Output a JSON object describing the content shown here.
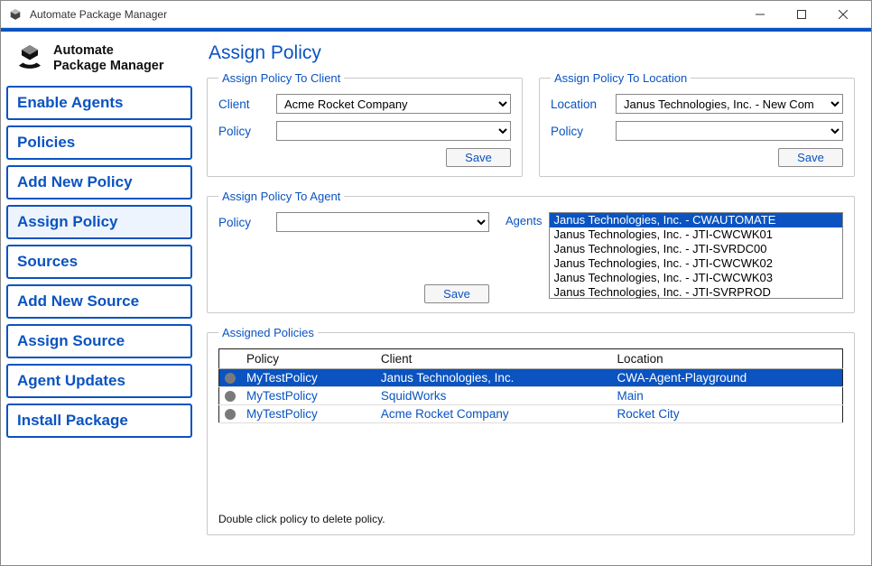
{
  "window": {
    "title": "Automate Package Manager"
  },
  "brand": {
    "line1": "Automate",
    "line2": "Package Manager"
  },
  "sidebar": {
    "items": [
      {
        "label": "Enable Agents"
      },
      {
        "label": "Policies"
      },
      {
        "label": "Add New Policy"
      },
      {
        "label": "Assign Policy"
      },
      {
        "label": "Sources"
      },
      {
        "label": "Add New Source"
      },
      {
        "label": "Assign Source"
      },
      {
        "label": "Agent Updates"
      },
      {
        "label": "Install Package"
      }
    ],
    "active_index": 3
  },
  "page": {
    "title": "Assign Policy"
  },
  "groups": {
    "client": {
      "legend": "Assign Policy To Client",
      "client_label": "Client",
      "policy_label": "Policy",
      "client_value": "Acme Rocket Company",
      "policy_value": "",
      "save_label": "Save"
    },
    "location": {
      "legend": "Assign Policy To Location",
      "location_label": "Location",
      "policy_label": "Policy",
      "location_value": "Janus Technologies, Inc. - New Com",
      "policy_value": "",
      "save_label": "Save"
    },
    "agent": {
      "legend": "Assign Policy To Agent",
      "policy_label": "Policy",
      "agents_label": "Agents",
      "policy_value": "",
      "save_label": "Save",
      "agents": [
        "Janus Technologies, Inc. - CWAUTOMATE",
        "Janus Technologies, Inc. - JTI-CWCWK01",
        "Janus Technologies, Inc. - JTI-SVRDC00",
        "Janus Technologies, Inc. - JTI-CWCWK02",
        "Janus Technologies, Inc. - JTI-CWCWK03",
        "Janus Technologies, Inc. - JTI-SVRPROD"
      ],
      "selected_agent_index": 0
    },
    "assigned": {
      "legend": "Assigned Policies",
      "columns": {
        "policy": "Policy",
        "client": "Client",
        "location": "Location"
      },
      "rows": [
        {
          "policy": "MyTestPolicy",
          "client": "Janus Technologies, Inc.",
          "location": "CWA-Agent-Playground",
          "selected": true
        },
        {
          "policy": "MyTestPolicy",
          "client": "SquidWorks",
          "location": "Main",
          "selected": false
        },
        {
          "policy": "MyTestPolicy",
          "client": "Acme Rocket Company",
          "location": "Rocket City",
          "selected": false
        }
      ],
      "hint": "Double click policy to delete policy."
    }
  }
}
